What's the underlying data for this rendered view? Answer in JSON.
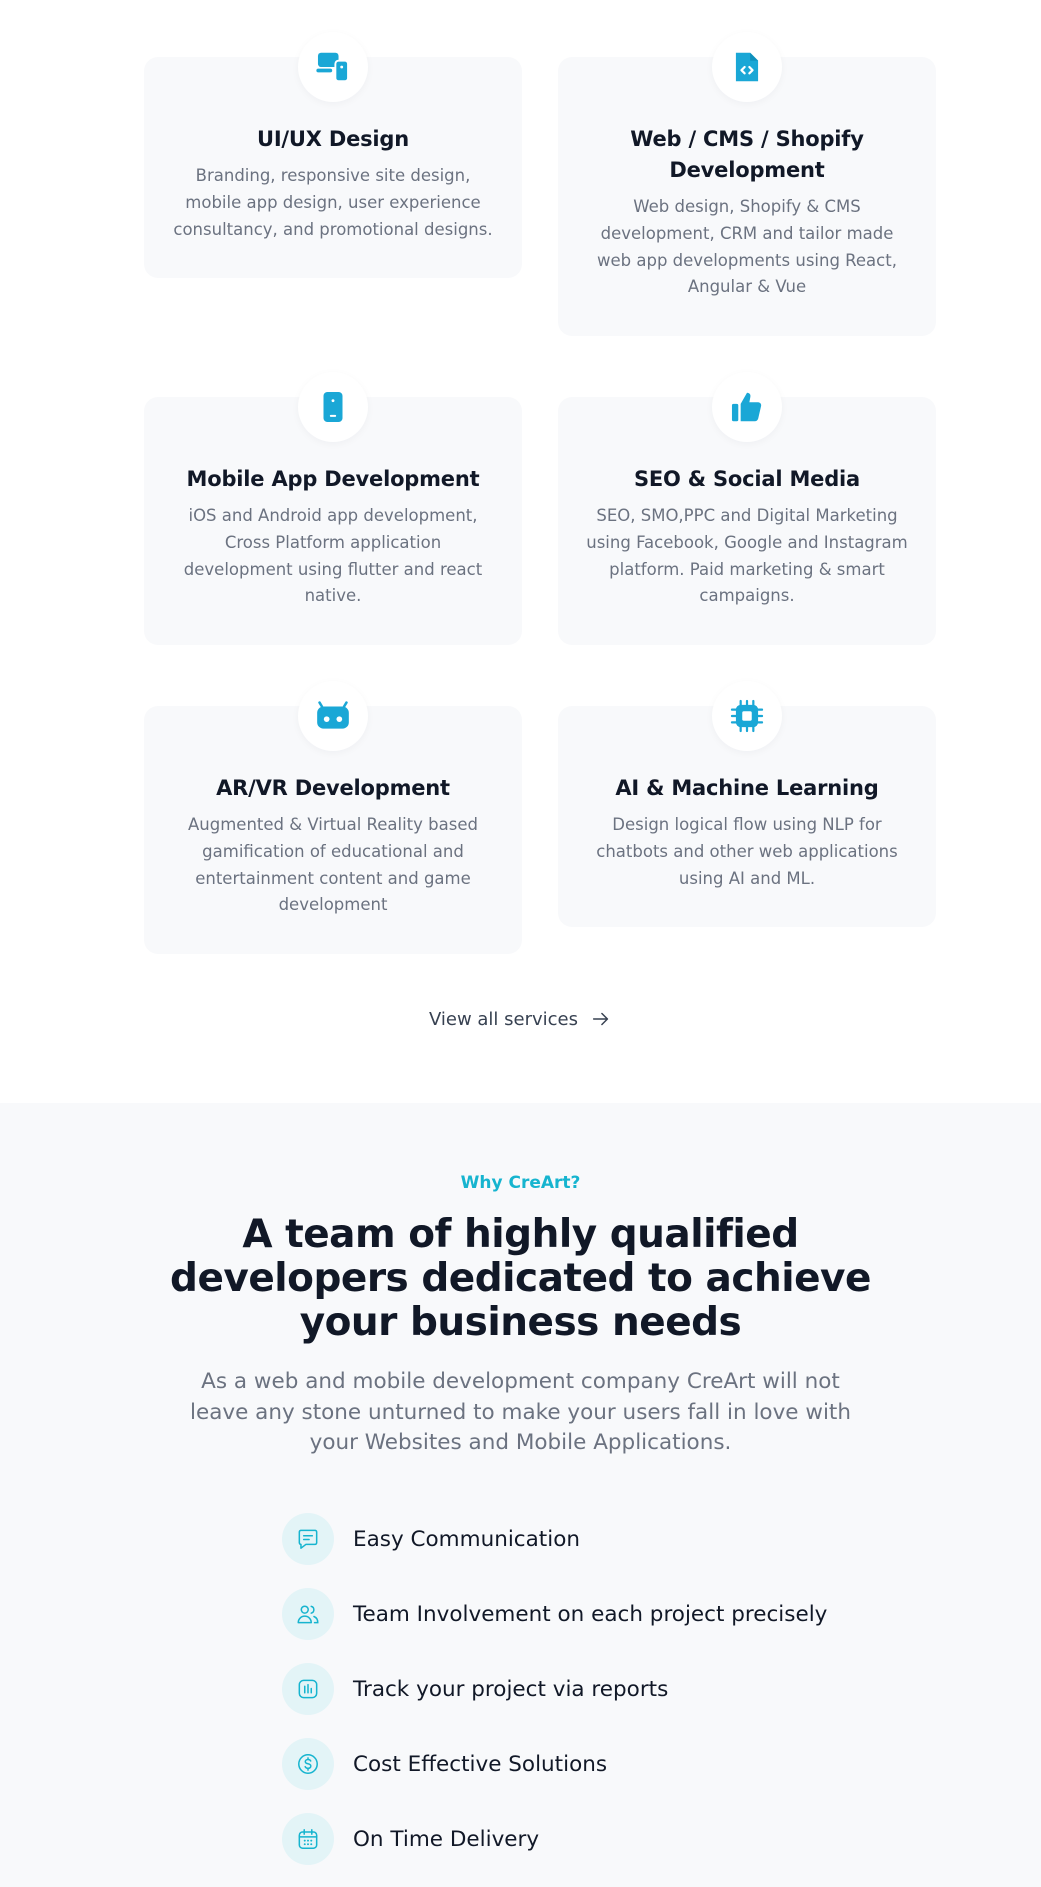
{
  "colors": {
    "accent": "#16b4cf",
    "heading": "#111827",
    "body_text": "#6b7280",
    "card_bg": "#f8f9fb",
    "icon_bg": "#e3f4f7"
  },
  "services": [
    {
      "icon": "devices-icon",
      "title": "UI/UX Design",
      "description": "Branding, responsive site design, mobile app design, user experience consultancy, and promotional designs."
    },
    {
      "icon": "code-file-icon",
      "title": "Web / CMS / Shopify Development",
      "description": "Web design, Shopify & CMS development, CRM and tailor made web app developments using React, Angular & Vue"
    },
    {
      "icon": "mobile-phone-icon",
      "title": "Mobile App Development",
      "description": "iOS and Android app development, Cross Platform application development using flutter and react native."
    },
    {
      "icon": "thumbs-up-icon",
      "title": "SEO & Social Media",
      "description": "SEO, SMO,PPC and Digital Marketing using Facebook, Google and Instagram platform. Paid marketing & smart campaigns."
    },
    {
      "icon": "vr-headset-icon",
      "title": "AR/VR Development",
      "description": "Augmented & Virtual Reality based gamification of educational and entertainment content and game development"
    },
    {
      "icon": "chip-icon",
      "title": "AI & Machine Learning",
      "description": "Design logical flow using NLP for chatbots and other web applications using AI and ML."
    }
  ],
  "view_all": {
    "label": "View all services",
    "icon": "arrow-right-icon"
  },
  "why": {
    "eyebrow": "Why CreArt?",
    "headline": "A team of highly qualified developers dedicated to achieve your business needs",
    "lede": "As a web and mobile development company CreArt will not leave any stone unturned to make your users fall in love with your Websites and Mobile Applications.",
    "features": [
      {
        "icon": "chat-icon",
        "label": "Easy Communication"
      },
      {
        "icon": "team-icon",
        "label": "Team Involvement on each project precisely"
      },
      {
        "icon": "report-icon",
        "label": "Track your project via reports"
      },
      {
        "icon": "dollar-icon",
        "label": "Cost Effective Solutions"
      },
      {
        "icon": "calendar-icon",
        "label": "On Time Delivery"
      }
    ]
  }
}
